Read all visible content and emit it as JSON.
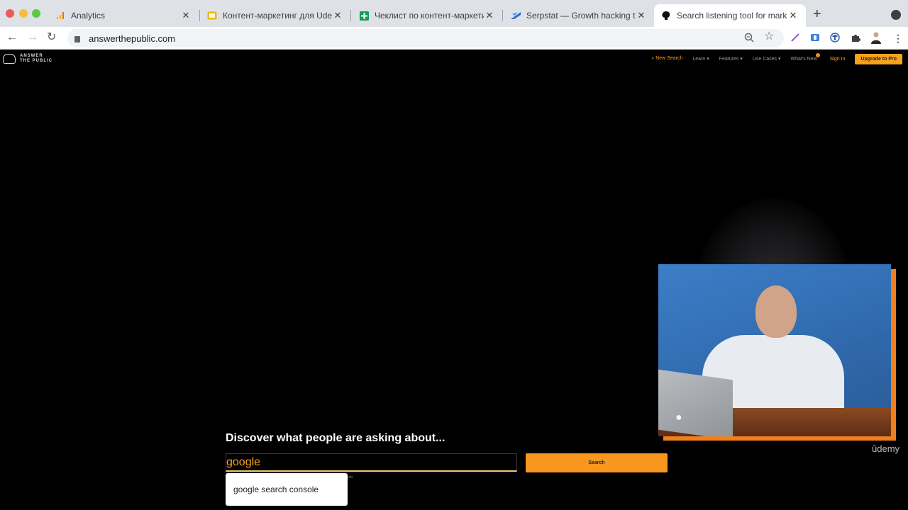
{
  "browser": {
    "tabs": [
      {
        "title": "Analytics",
        "icon": "analytics-icon",
        "active": false
      },
      {
        "title": "Контент-маркетинг для Udemy",
        "icon": "slides-icon",
        "active": false
      },
      {
        "title": "Чеклист по контент-маркетингу",
        "icon": "sheets-icon",
        "active": false
      },
      {
        "title": "Serpstat — Growth hacking tool",
        "icon": "serpstat-icon",
        "active": false
      },
      {
        "title": "Search listening tool for marketers",
        "icon": "answerthepublic-icon",
        "active": true
      }
    ],
    "new_tab": "+",
    "close_glyph": "✕",
    "url": "answerthepublic.com"
  },
  "site": {
    "logo_line1": "ANSWER",
    "logo_line2": "THE PUBLIC",
    "nav": {
      "new_search": "New Search",
      "learn": "Learn ▾",
      "features": "Features ▾",
      "use_cases": "Use Cases ▾",
      "whats_new": "What's New",
      "sign_in": "Sign In",
      "upgrade": "Upgrade to Pro"
    },
    "hero_title": "Discover what people are asking about...",
    "search_value": "google",
    "search_button": "Search",
    "hint": "ults",
    "suggestion": "google search console"
  },
  "overlay": {
    "watermark": "ûdemy"
  }
}
